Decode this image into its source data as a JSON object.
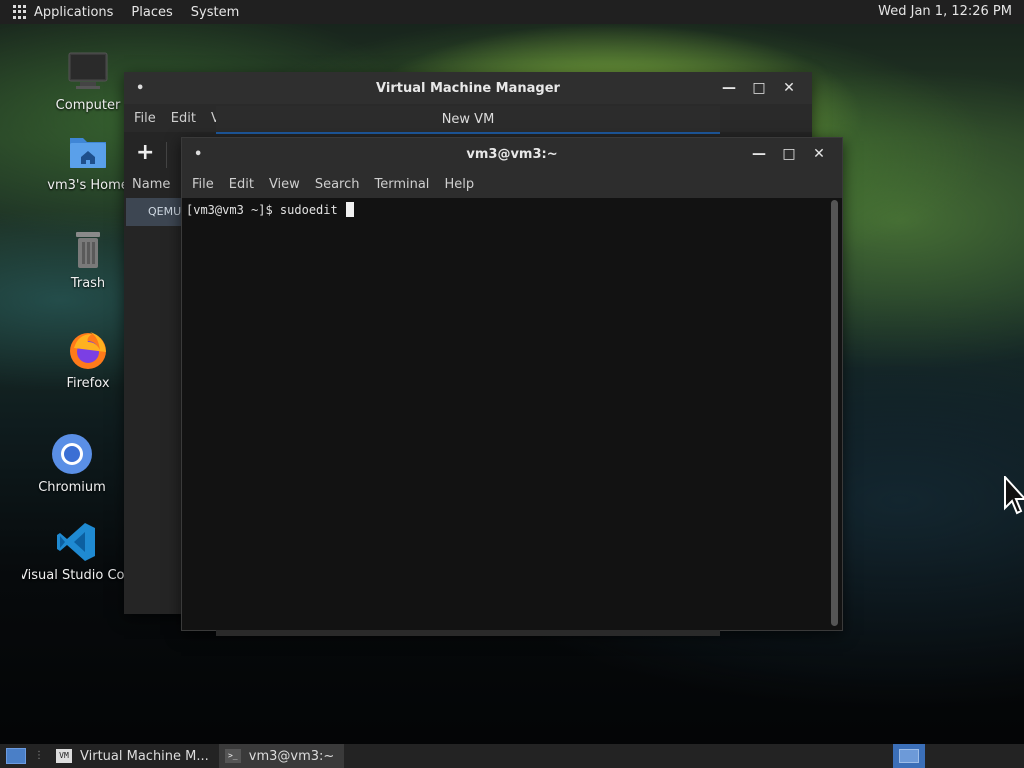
{
  "top_panel": {
    "applications": "Applications",
    "places": "Places",
    "system": "System",
    "clock": "Wed Jan  1, 12:26 PM"
  },
  "desktop_icons": [
    {
      "label": "Computer",
      "icon": "computer-icon"
    },
    {
      "label": "vm3's Home",
      "icon": "home-folder-icon"
    },
    {
      "label": "Trash",
      "icon": "trash-icon"
    },
    {
      "label": "Firefox",
      "icon": "firefox-icon"
    },
    {
      "label": "Chromium",
      "icon": "chromium-icon"
    },
    {
      "label": "Visual Studio Code",
      "icon": "vscode-icon"
    }
  ],
  "virt_manager": {
    "title": "Virtual Machine Manager",
    "menu": [
      "File",
      "Edit",
      "V"
    ],
    "new_vm_tab": "New VM",
    "column_name": "Name",
    "connection": "QEMU"
  },
  "terminal": {
    "title": "vm3@vm3:~",
    "menu": [
      "File",
      "Edit",
      "View",
      "Search",
      "Terminal",
      "Help"
    ],
    "prompt": "[vm3@vm3 ~]$ ",
    "command": "sudoedit "
  },
  "window_controls": {
    "dot": "•",
    "minimize": "—",
    "maximize": "□",
    "close": "✕"
  },
  "taskbar": {
    "tasks": [
      {
        "label": "Virtual Machine M...",
        "active": false
      },
      {
        "label": "vm3@vm3:~",
        "active": true
      }
    ]
  },
  "colors": {
    "panel": "#202020",
    "selection": "#3d4652",
    "accent": "#3b6fb8"
  }
}
